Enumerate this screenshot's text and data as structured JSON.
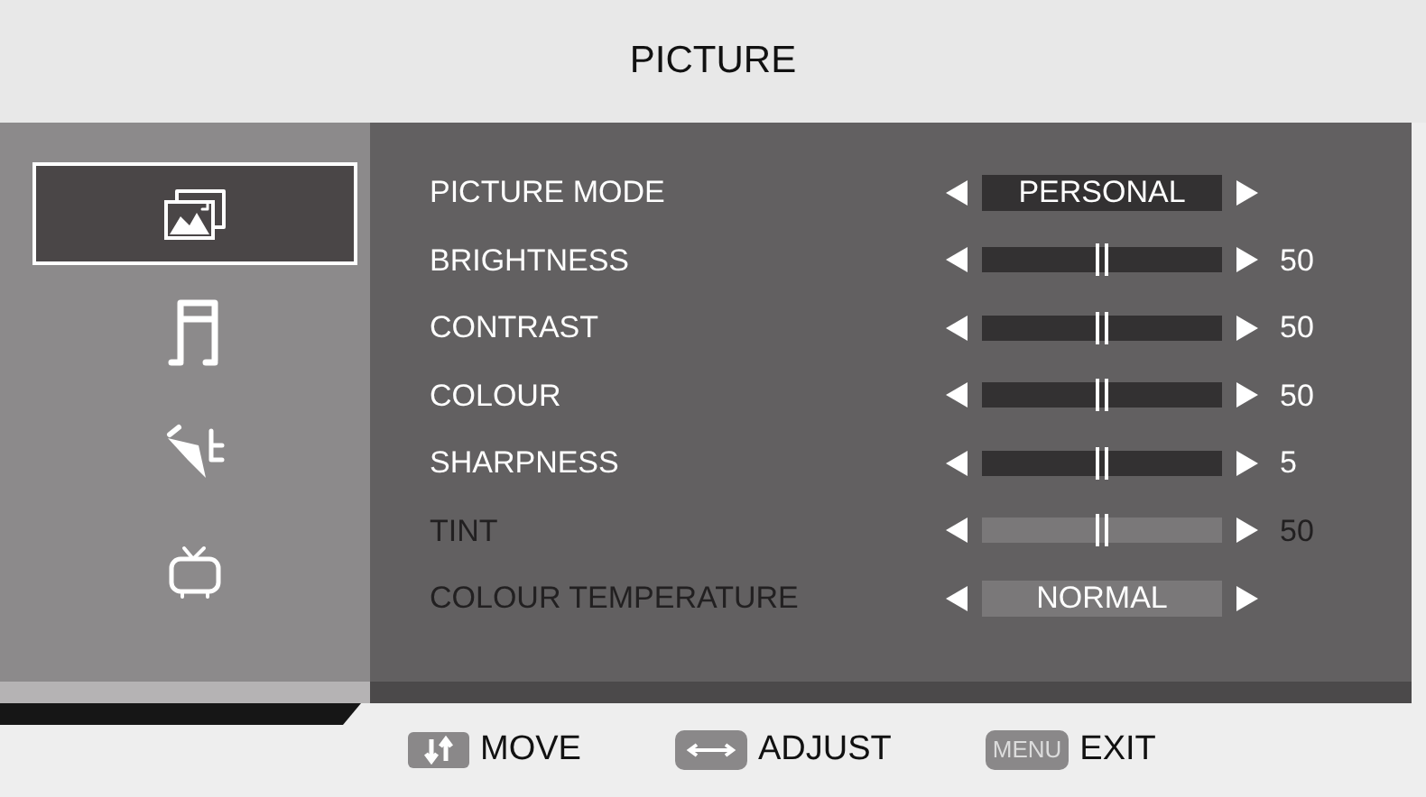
{
  "title": "PICTURE",
  "sidebar": {
    "items": [
      {
        "kind": "picture",
        "selected": true
      },
      {
        "kind": "music",
        "selected": false
      },
      {
        "kind": "tool",
        "selected": false
      },
      {
        "kind": "tv",
        "selected": false
      }
    ]
  },
  "settings": [
    {
      "kind": "option",
      "label": "PICTURE MODE",
      "value": "PERSONAL",
      "disabled": false
    },
    {
      "kind": "slider",
      "label": "BRIGHTNESS",
      "reading": "50",
      "disabled": false
    },
    {
      "kind": "slider",
      "label": "CONTRAST",
      "reading": "50",
      "disabled": false
    },
    {
      "kind": "slider",
      "label": "COLOUR",
      "reading": "50",
      "disabled": false
    },
    {
      "kind": "slider",
      "label": "SHARPNESS",
      "reading": "5",
      "disabled": false
    },
    {
      "kind": "slider",
      "label": "TINT",
      "reading": "50",
      "disabled": true
    },
    {
      "kind": "option",
      "label": "COLOUR TEMPERATURE",
      "value": "NORMAL",
      "disabled": true
    }
  ],
  "footer": [
    {
      "kind": "updown",
      "label": "MOVE"
    },
    {
      "kind": "leftright",
      "label": "ADJUST"
    },
    {
      "kind": "text",
      "key_label": "MENU",
      "label": "EXIT"
    }
  ]
}
